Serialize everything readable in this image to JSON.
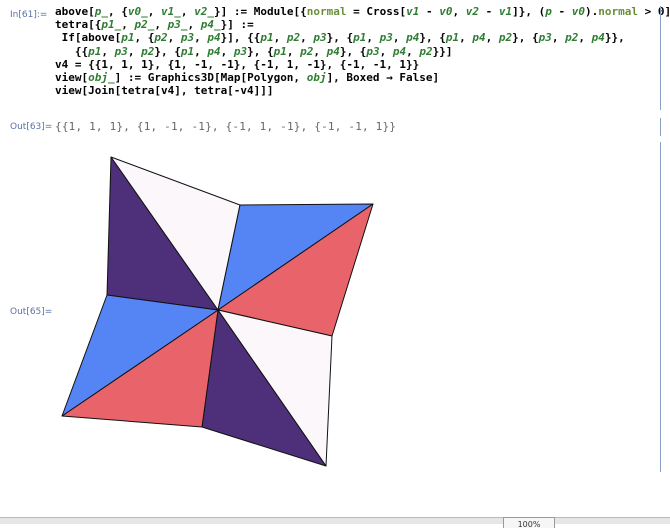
{
  "cells": {
    "input_label": "In[61]:=",
    "input_lines": [
      [
        {
          "t": "above[",
          "c": "k"
        },
        {
          "t": "p_",
          "c": "v"
        },
        {
          "t": ", {",
          "c": "k"
        },
        {
          "t": "v0_",
          "c": "v"
        },
        {
          "t": ", ",
          "c": "k"
        },
        {
          "t": "v1_",
          "c": "v"
        },
        {
          "t": ", ",
          "c": "k"
        },
        {
          "t": "v2_",
          "c": "v"
        },
        {
          "t": "}] := Module[{",
          "c": "k"
        },
        {
          "t": "normal",
          "c": "g"
        },
        {
          "t": " = Cross[",
          "c": "k"
        },
        {
          "t": "v1",
          "c": "v"
        },
        {
          "t": " - ",
          "c": "k"
        },
        {
          "t": "v0",
          "c": "v"
        },
        {
          "t": ", ",
          "c": "k"
        },
        {
          "t": "v2",
          "c": "v"
        },
        {
          "t": " - ",
          "c": "k"
        },
        {
          "t": "v1",
          "c": "v"
        },
        {
          "t": "]}, (",
          "c": "k"
        },
        {
          "t": "p",
          "c": "v"
        },
        {
          "t": " - ",
          "c": "k"
        },
        {
          "t": "v0",
          "c": "v"
        },
        {
          "t": ").",
          "c": "k"
        },
        {
          "t": "normal",
          "c": "g"
        },
        {
          "t": " > 0]",
          "c": "k"
        }
      ],
      [
        {
          "t": "tetra[{",
          "c": "k"
        },
        {
          "t": "p1_",
          "c": "v"
        },
        {
          "t": ", ",
          "c": "k"
        },
        {
          "t": "p2_",
          "c": "v"
        },
        {
          "t": ", ",
          "c": "k"
        },
        {
          "t": "p3_",
          "c": "v"
        },
        {
          "t": ", ",
          "c": "k"
        },
        {
          "t": "p4_",
          "c": "v"
        },
        {
          "t": "}] :=",
          "c": "k"
        }
      ],
      [
        {
          "t": " If[above[",
          "c": "k"
        },
        {
          "t": "p1",
          "c": "v"
        },
        {
          "t": ", {",
          "c": "k"
        },
        {
          "t": "p2",
          "c": "v"
        },
        {
          "t": ", ",
          "c": "k"
        },
        {
          "t": "p3",
          "c": "v"
        },
        {
          "t": ", ",
          "c": "k"
        },
        {
          "t": "p4",
          "c": "v"
        },
        {
          "t": "}], {{",
          "c": "k"
        },
        {
          "t": "p1",
          "c": "v"
        },
        {
          "t": ", ",
          "c": "k"
        },
        {
          "t": "p2",
          "c": "v"
        },
        {
          "t": ", ",
          "c": "k"
        },
        {
          "t": "p3",
          "c": "v"
        },
        {
          "t": "}, {",
          "c": "k"
        },
        {
          "t": "p1",
          "c": "v"
        },
        {
          "t": ", ",
          "c": "k"
        },
        {
          "t": "p3",
          "c": "v"
        },
        {
          "t": ", ",
          "c": "k"
        },
        {
          "t": "p4",
          "c": "v"
        },
        {
          "t": "}, {",
          "c": "k"
        },
        {
          "t": "p1",
          "c": "v"
        },
        {
          "t": ", ",
          "c": "k"
        },
        {
          "t": "p4",
          "c": "v"
        },
        {
          "t": ", ",
          "c": "k"
        },
        {
          "t": "p2",
          "c": "v"
        },
        {
          "t": "}, {",
          "c": "k"
        },
        {
          "t": "p3",
          "c": "v"
        },
        {
          "t": ", ",
          "c": "k"
        },
        {
          "t": "p2",
          "c": "v"
        },
        {
          "t": ", ",
          "c": "k"
        },
        {
          "t": "p4",
          "c": "v"
        },
        {
          "t": "}},",
          "c": "k"
        }
      ],
      [
        {
          "t": "   {{",
          "c": "k"
        },
        {
          "t": "p1",
          "c": "v"
        },
        {
          "t": ", ",
          "c": "k"
        },
        {
          "t": "p3",
          "c": "v"
        },
        {
          "t": ", ",
          "c": "k"
        },
        {
          "t": "p2",
          "c": "v"
        },
        {
          "t": "}, {",
          "c": "k"
        },
        {
          "t": "p1",
          "c": "v"
        },
        {
          "t": ", ",
          "c": "k"
        },
        {
          "t": "p4",
          "c": "v"
        },
        {
          "t": ", ",
          "c": "k"
        },
        {
          "t": "p3",
          "c": "v"
        },
        {
          "t": "}, {",
          "c": "k"
        },
        {
          "t": "p1",
          "c": "v"
        },
        {
          "t": ", ",
          "c": "k"
        },
        {
          "t": "p2",
          "c": "v"
        },
        {
          "t": ", ",
          "c": "k"
        },
        {
          "t": "p4",
          "c": "v"
        },
        {
          "t": "}, {",
          "c": "k"
        },
        {
          "t": "p3",
          "c": "v"
        },
        {
          "t": ", ",
          "c": "k"
        },
        {
          "t": "p4",
          "c": "v"
        },
        {
          "t": ", ",
          "c": "k"
        },
        {
          "t": "p2",
          "c": "v"
        },
        {
          "t": "}}]",
          "c": "k"
        }
      ],
      [
        {
          "t": "v4 = {{1, 1, 1}, {1, -1, -1}, {-1, 1, -1}, {-1, -1, 1}}",
          "c": "k"
        }
      ],
      [
        {
          "t": "view[",
          "c": "k"
        },
        {
          "t": "obj_",
          "c": "v"
        },
        {
          "t": "] := Graphics3D[Map[Polygon, ",
          "c": "k"
        },
        {
          "t": "obj",
          "c": "v"
        },
        {
          "t": "], Boxed → False]",
          "c": "k"
        }
      ],
      [
        {
          "t": "view[Join[tetra[v4], tetra[-v4]]]",
          "c": "k"
        }
      ]
    ],
    "output1_label": "Out[63]=",
    "output1_text": "{{1, 1, 1}, {1, -1, -1}, {-1, 1, -1}, {-1, -1, 1}}",
    "output2_label": "Out[65]="
  },
  "graphic": {
    "colors": {
      "purple": "#4e2f7a",
      "white": "#fbf7fb",
      "blue": "#5585f5",
      "red": "#e8646a",
      "edge": "#111111"
    }
  },
  "status": {
    "zoom": "100%"
  }
}
